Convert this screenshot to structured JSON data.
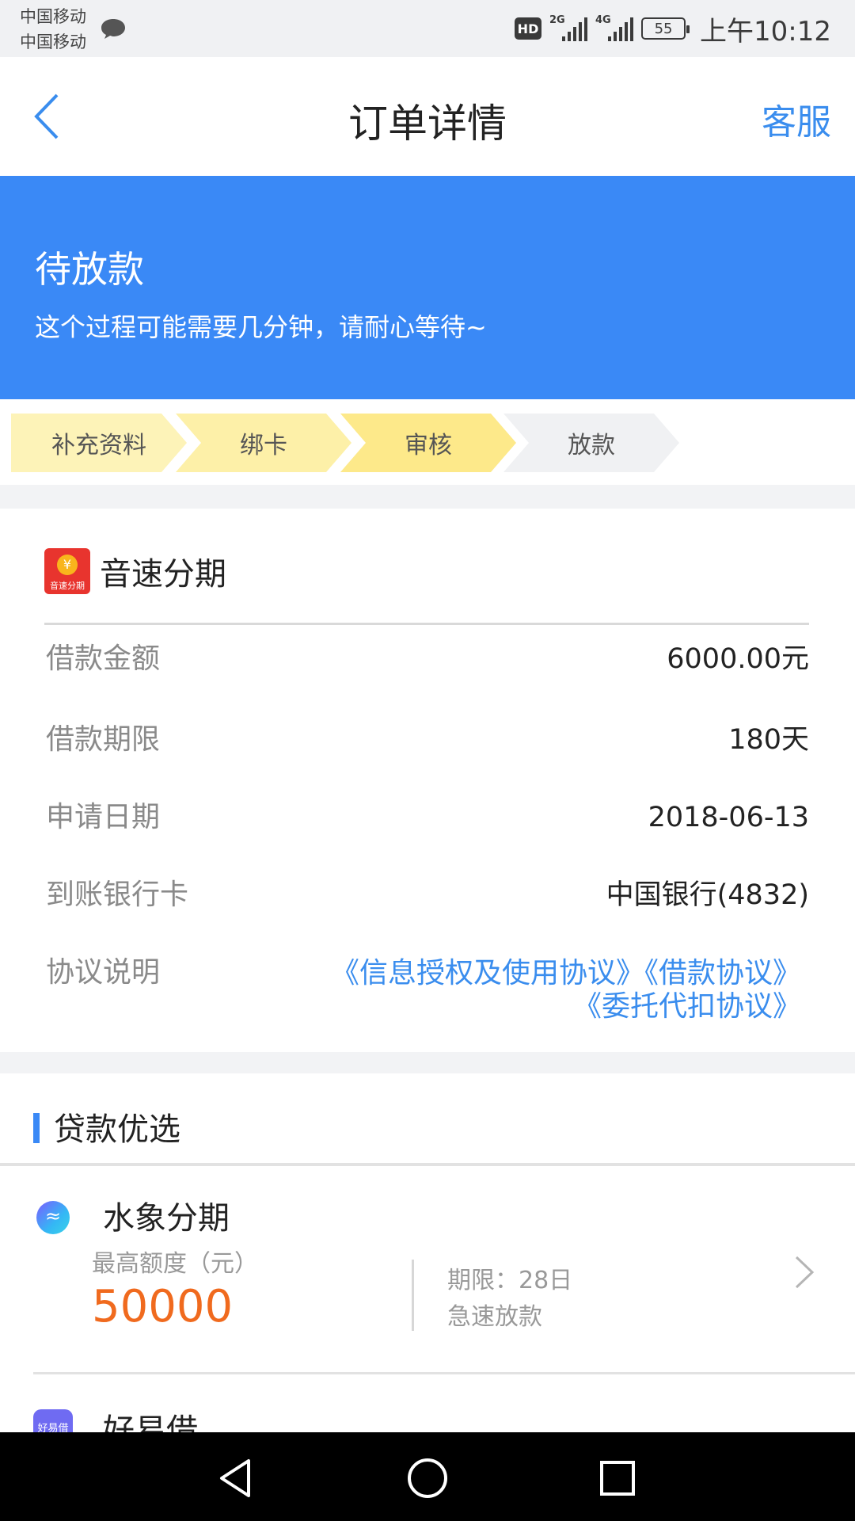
{
  "status_bar": {
    "carrier_1": "中国移动",
    "carrier_2": "中国移动",
    "hd": "HD",
    "net_1": "2G",
    "net_2": "4G",
    "battery": "55",
    "time": "上午10:12"
  },
  "header": {
    "title": "订单详情",
    "service": "客服"
  },
  "banner": {
    "title": "待放款",
    "subtitle": "这个过程可能需要几分钟，请耐心等待~"
  },
  "steps": [
    {
      "label": "补充资料",
      "color": "#fdf3b8"
    },
    {
      "label": "绑卡",
      "color": "#fdf0a8"
    },
    {
      "label": "审核",
      "color": "#fde98a"
    },
    {
      "label": "放款",
      "color": "#f0f1f3"
    }
  ],
  "card": {
    "brand_name": "音速分期",
    "brand_logo_text": "音速分期",
    "brand_logo_symbol": "¥",
    "rows": [
      {
        "label": "借款金额",
        "value": "6000.00元"
      },
      {
        "label": "借款期限",
        "value": "180天"
      },
      {
        "label": "申请日期",
        "value": "2018-06-13"
      },
      {
        "label": "到账银行卡",
        "value": "中国银行(4832)"
      }
    ],
    "agreement_label": "协议说明",
    "agreements": [
      "《信息授权及使用协议》",
      "《借款协议》",
      "《委托代扣协议》"
    ]
  },
  "recommend": {
    "title": "贷款优选",
    "items": [
      {
        "name": "水象分期",
        "limit_label": "最高额度（元）",
        "limit_value": "50000",
        "term": "期限：28日",
        "tag": "急速放款"
      },
      {
        "name": "好易借",
        "logo_text": "好易借"
      }
    ]
  },
  "colors": {
    "accent": "#3a89f6",
    "link": "#3a8dee",
    "amount": "#f06a1e"
  }
}
